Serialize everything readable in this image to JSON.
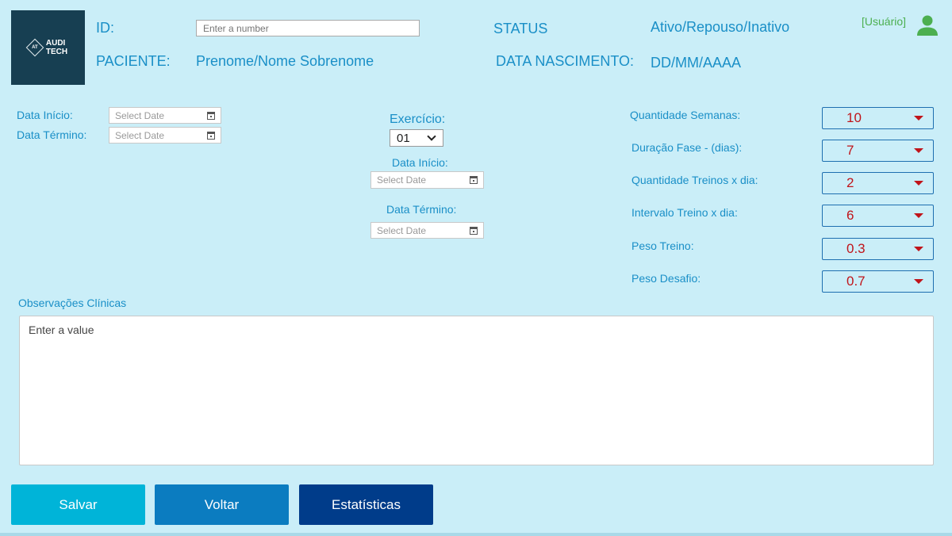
{
  "logo": {
    "mark": "AT",
    "line1": "AUDI",
    "line2": "TECH"
  },
  "header": {
    "id_label": "ID:",
    "id_placeholder": "Enter a number",
    "status_label": "STATUS",
    "status_value": "Ativo/Repouso/Inativo",
    "paciente_label": "PACIENTE:",
    "paciente_value": "Prenome/Nome Sobrenome",
    "nascimento_label": "DATA NASCIMENTO:",
    "nascimento_value": "DD/MM/AAAA",
    "usuario": "[Usuário]",
    "user_icon": "user-icon"
  },
  "left_dates": {
    "inicio_label": "Data Início:",
    "inicio_placeholder": "Select Date",
    "termino_label": "Data Término:",
    "termino_placeholder": "Select Date"
  },
  "exercise": {
    "label": "Exercício:",
    "selected": "01",
    "inicio_label": "Data Início:",
    "inicio_placeholder": "Select Date",
    "termino_label": "Data Término:",
    "termino_placeholder": "Select Date"
  },
  "settings": [
    {
      "label": "Quantidade Semanas:",
      "value": "10"
    },
    {
      "label": "Duração Fase - (dias):",
      "value": "7"
    },
    {
      "label": "Quantidade Treinos x dia:",
      "value": "2"
    },
    {
      "label": "Intervalo Treino x dia:",
      "value": "6"
    },
    {
      "label": "Peso Treino:",
      "value": "0.3"
    },
    {
      "label": "Peso Desafio:",
      "value": "0.7"
    }
  ],
  "observacoes": {
    "label": "Observações Clínicas",
    "placeholder": "Enter a value"
  },
  "buttons": {
    "salvar": "Salvar",
    "voltar": "Voltar",
    "estatisticas": "Estatísticas"
  },
  "colors": {
    "background": "#caeef8",
    "accent_text": "#1a8fc7",
    "dropdown_value": "#c0141a",
    "salvar": "#00b4d8",
    "voltar": "#0b7cc0",
    "estatisticas": "#003c8a",
    "usuario": "#4caf50"
  }
}
